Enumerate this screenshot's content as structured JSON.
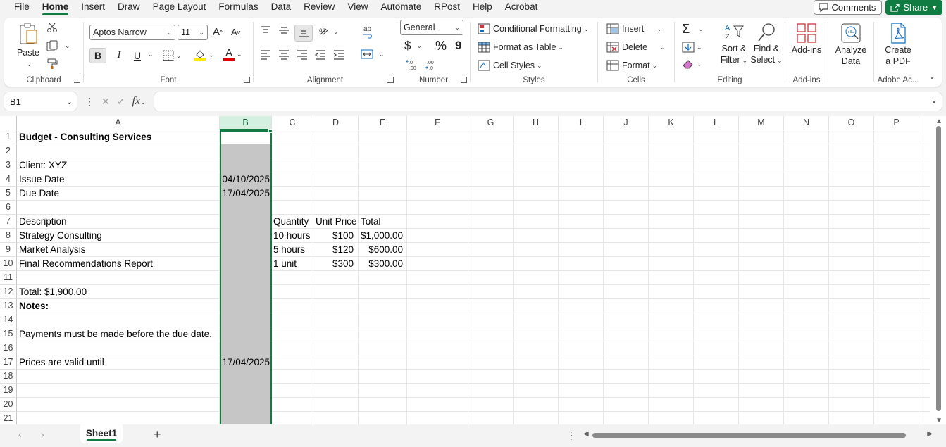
{
  "menu": {
    "tabs": [
      "File",
      "Home",
      "Insert",
      "Draw",
      "Page Layout",
      "Formulas",
      "Data",
      "Review",
      "View",
      "Automate",
      "RPost",
      "Help",
      "Acrobat"
    ],
    "active": "Home",
    "comments_label": "Comments",
    "share_label": "Share"
  },
  "ribbon": {
    "clipboard": {
      "label": "Clipboard",
      "paste": "Paste"
    },
    "font": {
      "label": "Font",
      "name": "Aptos Narrow",
      "size": "11",
      "bold": "B",
      "italic": "I",
      "underline": "U",
      "font_color": "A"
    },
    "alignment": {
      "label": "Alignment"
    },
    "number": {
      "label": "Number",
      "format": "General",
      "currency": "$",
      "percent": "%",
      "comma": "9"
    },
    "styles": {
      "label": "Styles",
      "conditional": "Conditional Formatting",
      "format_table": "Format as Table",
      "cell_styles": "Cell Styles"
    },
    "cells": {
      "label": "Cells",
      "insert": "Insert",
      "delete": "Delete",
      "format": "Format"
    },
    "editing": {
      "label": "Editing",
      "sort_filter_1": "Sort &",
      "sort_filter_2": "Filter",
      "find_select_1": "Find &",
      "find_select_2": "Select"
    },
    "addins": {
      "label": "Add-ins",
      "addins_btn": "Add-ins"
    },
    "analyze": {
      "line1": "Analyze",
      "line2": "Data"
    },
    "adobe": {
      "label": "Adobe Ac...",
      "line1": "Create",
      "line2": "a PDF"
    }
  },
  "formula_bar": {
    "name_box": "B1",
    "fx": "fx",
    "value": ""
  },
  "columns": [
    "A",
    "B",
    "C",
    "D",
    "E",
    "F",
    "G",
    "H",
    "I",
    "J",
    "K",
    "L",
    "M",
    "N",
    "O",
    "P"
  ],
  "rows": [
    "1",
    "2",
    "3",
    "4",
    "5",
    "6",
    "7",
    "8",
    "9",
    "10",
    "11",
    "12",
    "13",
    "14",
    "15",
    "16",
    "17",
    "18",
    "19",
    "20",
    "21"
  ],
  "cells": {
    "A1": "Budget - Consulting Services",
    "A3": "Client: XYZ",
    "A4": "Issue Date",
    "B4": "04/10/2025",
    "A5": "Due Date",
    "B5": "17/04/2025",
    "A7": "Description",
    "C7": "Quantity",
    "D7": "Unit Price",
    "E7": "Total",
    "A8": "Strategy Consulting",
    "C8": "10 hours",
    "D8": "$100",
    "E8": "$1,000.00",
    "A9": "Market Analysis",
    "C9": "5 hours",
    "D9": "$120",
    "E9": "$600.00",
    "A10": "Final Recommendations Report",
    "C10": "1 unit",
    "D10": "$300",
    "E10": "$300.00",
    "A12": "Total: $1,900.00",
    "A13": "Notes:",
    "A15": "Payments must be made before the due date.",
    "A17": "Prices are valid until",
    "B17": "17/04/2025"
  },
  "sheets": {
    "active": "Sheet1",
    "add": "+"
  },
  "colors": {
    "accent": "#107c41",
    "selection_fill": "#c6c6c6",
    "font_highlight": "#ffeb00",
    "font_red": "#e00000"
  }
}
